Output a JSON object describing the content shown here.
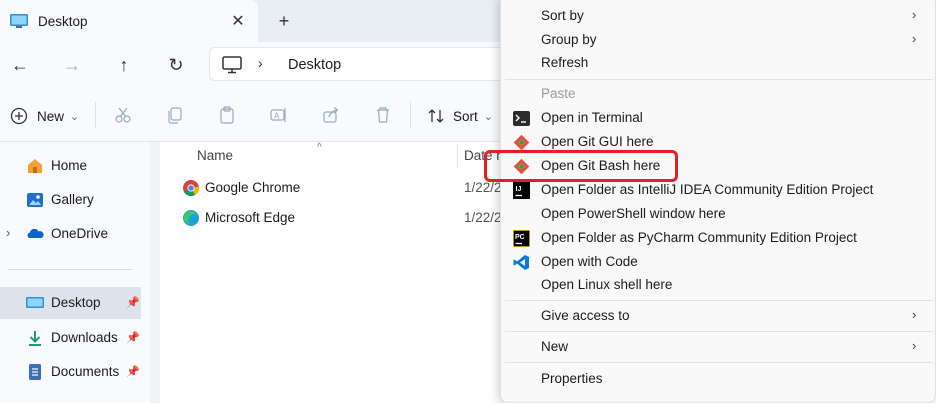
{
  "tab": {
    "title": "Desktop",
    "close_glyph": "✕",
    "new_glyph": "+"
  },
  "nav": {
    "back": "←",
    "forward": "→",
    "up": "↑",
    "refresh": "↻"
  },
  "address": {
    "chevron": "›",
    "path": "Desktop"
  },
  "toolbar": {
    "new_label": "New",
    "sort_label": "Sort",
    "dropdown": "⌄"
  },
  "sidebar": {
    "items": [
      {
        "label": "Home",
        "icon": "home-icon"
      },
      {
        "label": "Gallery",
        "icon": "gallery-icon"
      },
      {
        "label": "OneDrive",
        "icon": "onedrive-icon",
        "expander": "›"
      },
      {
        "label": "Desktop",
        "icon": "desktop-icon",
        "pin": "📌"
      },
      {
        "label": "Downloads",
        "icon": "downloads-icon",
        "pin": "📌"
      },
      {
        "label": "Documents",
        "icon": "documents-icon",
        "pin": "📌"
      }
    ]
  },
  "content": {
    "columns": {
      "name": "Name",
      "date": "Date m",
      "sort_glyph": "^"
    },
    "files": [
      {
        "name": "Google Chrome",
        "date": "1/22/2",
        "icon": "chrome-icon"
      },
      {
        "name": "Microsoft Edge",
        "date": "1/22/2",
        "icon": "edge-icon"
      }
    ]
  },
  "menu": {
    "submenu_arrow": "›",
    "items": [
      {
        "label": "Sort by",
        "submenu": true
      },
      {
        "label": "Group by",
        "submenu": true
      },
      {
        "label": "Refresh"
      },
      {
        "label": "Paste",
        "disabled": true
      },
      {
        "label": "Open in Terminal",
        "icon": "terminal-icon"
      },
      {
        "label": "Open Git GUI here",
        "icon": "git-icon"
      },
      {
        "label": "Open Git Bash here",
        "icon": "git-icon"
      },
      {
        "label": "Open Folder as IntelliJ IDEA Community Edition Project",
        "icon": "intellij-icon"
      },
      {
        "label": "Open PowerShell window here"
      },
      {
        "label": "Open Folder as PyCharm Community Edition Project",
        "icon": "pycharm-icon"
      },
      {
        "label": "Open with Code",
        "icon": "vscode-icon"
      },
      {
        "label": "Open Linux shell here"
      },
      {
        "label": "Give access to",
        "submenu": true
      },
      {
        "label": "New",
        "submenu": true
      },
      {
        "label": "Properties"
      }
    ]
  },
  "colors": {
    "highlight": "#e0241b",
    "accent": "#0a64c8"
  }
}
